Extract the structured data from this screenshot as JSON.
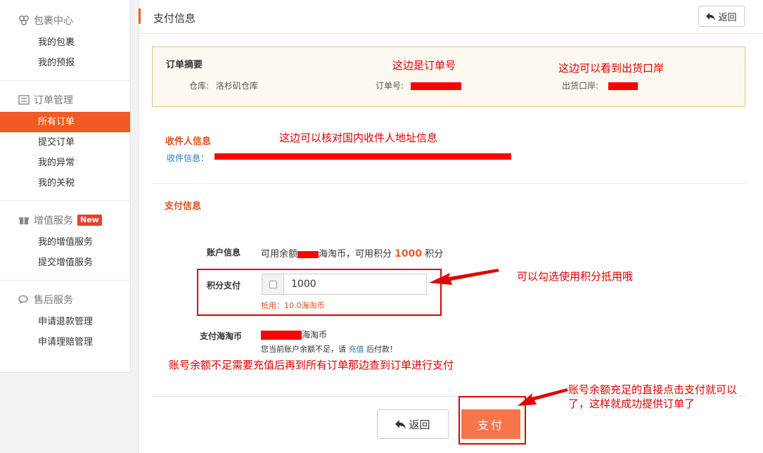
{
  "sidebar": {
    "groups": [
      {
        "title": "包裹中心",
        "icon": "boxes-icon",
        "items": [
          "我的包裹",
          "我的预报"
        ]
      },
      {
        "title": "订单管理",
        "icon": "list-icon",
        "items": [
          "所有订单",
          "提交订单",
          "我的异常",
          "我的关税"
        ]
      },
      {
        "title": "增值服务",
        "icon": "gift-icon",
        "badge": "New",
        "items": [
          "我的增值服务",
          "提交增值服务"
        ]
      },
      {
        "title": "售后服务",
        "icon": "chat-icon",
        "items": [
          "申请退款管理",
          "申请理赔管理"
        ]
      }
    ],
    "active_item": "所有订单"
  },
  "header": {
    "title": "支付信息",
    "back_label": "返回"
  },
  "summary": {
    "title": "订单摘要",
    "warehouse_label": "仓库:",
    "warehouse_value": "洛杉矶仓库",
    "order_no_label": "订单号:",
    "port_label": "出货口岸:"
  },
  "receiver": {
    "title": "收件人信息",
    "label": "收件信息："
  },
  "payment": {
    "title": "支付信息",
    "account_label": "账户信息",
    "account_prefix": "可用余额",
    "account_mid": "海淘币，可用积分",
    "points": "1000",
    "points_unit": "积分",
    "points_pay_label": "积分支付",
    "points_input": "1000",
    "deduct_text": "抵用：10.0海淘币",
    "pay_coin_label": "支付海淘币",
    "pay_coin_unit": "海淘币",
    "insufficient_prefix": "您当前账户余额不足，请",
    "recharge_link": "充值",
    "insufficient_suffix": "后付款！"
  },
  "footer": {
    "back_label": "返回",
    "pay_label": "支付"
  },
  "annotations": {
    "order_no": "这边是订单号",
    "port": "这边可以看到出货口岸",
    "receiver": "这边可以核对国内收件人地址信息",
    "points": "可以勾选使用积分抵用哦",
    "insufficient": "账号余额不足需要充值后再到所有订单那边查到订单进行支付",
    "sufficient_line1": "账号余额充足的直接点击支付就可以",
    "sufficient_line2": "了，这样就成功提供订单了"
  },
  "colors": {
    "accent": "#f15a23",
    "annotation": "#e00000",
    "summary_bg": "#fdf8f0"
  }
}
